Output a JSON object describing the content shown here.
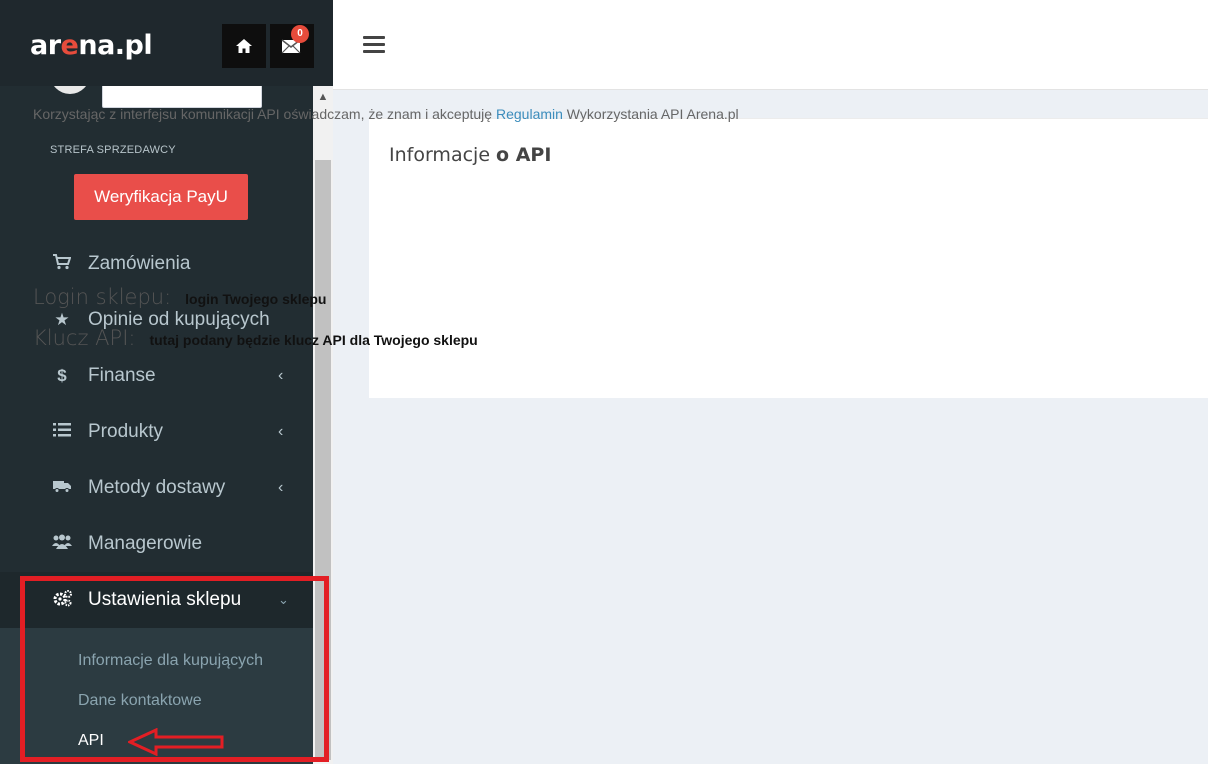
{
  "header": {
    "logo_prefix": "ar",
    "logo_accent": "e",
    "logo_suffix": "na.pl",
    "mail_badge": "0"
  },
  "sidebar": {
    "section_label": "STREFA SPRZEDAWCY",
    "payu_button": "Weryfikacja PayU",
    "items": [
      {
        "label": "Zamówienia",
        "icon": "cart-icon"
      },
      {
        "label": "Opinie od kupujących",
        "icon": "star-icon"
      },
      {
        "label": "Finanse",
        "icon": "dollar-icon",
        "chevron": "‹"
      },
      {
        "label": "Produkty",
        "icon": "list-icon",
        "chevron": "‹"
      },
      {
        "label": "Metody dostawy",
        "icon": "truck-icon",
        "chevron": "‹"
      },
      {
        "label": "Managerowie",
        "icon": "users-icon"
      }
    ],
    "active_item": {
      "label": "Ustawienia sklepu",
      "icon": "gears-icon",
      "chevron": "⌄"
    },
    "submenu": [
      {
        "label": "Informacje dla kupujących"
      },
      {
        "label": "Dane kontaktowe"
      },
      {
        "label": "API"
      }
    ]
  },
  "main": {
    "card_title_prefix": "Informacje ",
    "card_title_bold": "o API",
    "intro_before": "Korzystając z interfejsu komunikacji API oświadczam, że znam i akceptuję ",
    "intro_link": "Regulamin",
    "intro_after": " Wykorzystania API Arena.pl",
    "login_label": "Login sklepu:",
    "login_value": "login Twojego sklepu",
    "api_key_label": "Klucz API:",
    "api_key_value": "tutaj podany będzie klucz API dla Twojego sklepu"
  },
  "colors": {
    "sidebar_bg": "#222d32",
    "payu_red": "#e94e4a",
    "link_blue": "#3c8dbc",
    "highlight_red": "#e31e24"
  }
}
